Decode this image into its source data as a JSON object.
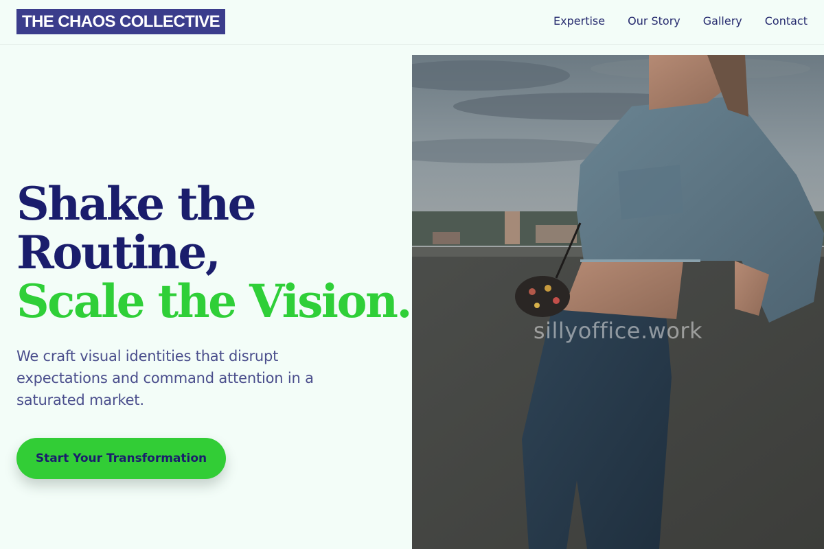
{
  "header": {
    "logo_text": "THE CHAOS COLLECTIVE",
    "nav": [
      {
        "label": "Expertise"
      },
      {
        "label": "Our Story"
      },
      {
        "label": "Gallery"
      },
      {
        "label": "Contact"
      }
    ]
  },
  "hero": {
    "headline_line1": "Shake the",
    "headline_line2": "Routine,",
    "headline_line3": "Scale the Vision.",
    "lede": "We craft visual identities that disrupt expectations and command attention in a saturated market.",
    "cta_label": "Start Your Transformation",
    "photo_watermark": "sillyoffice.work"
  },
  "colors": {
    "background": "#f3fdf8",
    "brand_navy": "#1a1d6c",
    "logo_bg": "#3b3d8c",
    "accent_green": "#2fcf38"
  }
}
